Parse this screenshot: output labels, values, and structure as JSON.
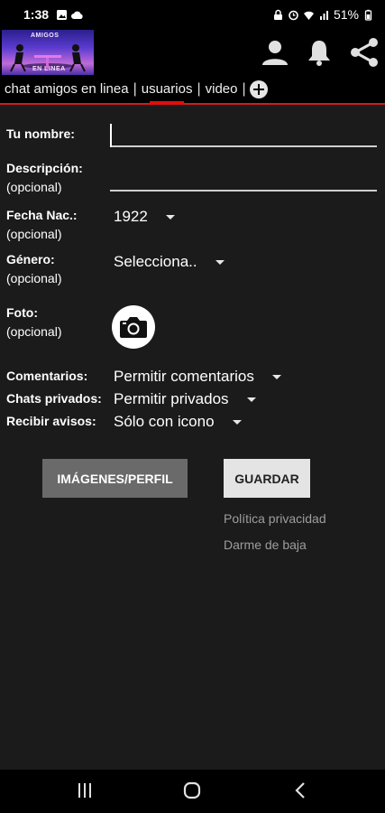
{
  "status_bar": {
    "time": "1:38",
    "battery": "51%"
  },
  "app_bar": {
    "logo_alt": "Amigos en línea",
    "logo_text_top": "AMIGOS",
    "logo_text_bottom": "EN LINEA"
  },
  "tabs": [
    {
      "label": "chat amigos en linea",
      "active": false
    },
    {
      "label": "usuarios",
      "active": true
    },
    {
      "label": "video",
      "active": false
    }
  ],
  "tab_separator": "|",
  "form": {
    "name_label": "Tu nombre:",
    "name_value": "",
    "description_label": "Descripción:",
    "optional_text": "(opcional)",
    "description_value": "",
    "birth_label": "Fecha Nac.:",
    "birth_value": "1922",
    "gender_label": "Género:",
    "gender_value": "Selecciona..",
    "photo_label": "Foto:",
    "comments_label": "Comentarios:",
    "comments_value": "Permitir comentarios",
    "private_label": "Chats privados:",
    "private_value": "Permitir privados",
    "notify_label": "Recibir avisos:",
    "notify_value": "Sólo con icono"
  },
  "buttons": {
    "images_label": "IMÁGENES/PERFIL",
    "save_label": "GUARDAR"
  },
  "links": {
    "privacy": "Política privacidad",
    "unsubscribe": "Darme de baja"
  },
  "colors": {
    "accent": "#e10e0e",
    "background": "#1b1b1b"
  },
  "icons": [
    "user-icon",
    "bell-icon",
    "share-icon",
    "camera-icon",
    "add-tab-icon"
  ]
}
